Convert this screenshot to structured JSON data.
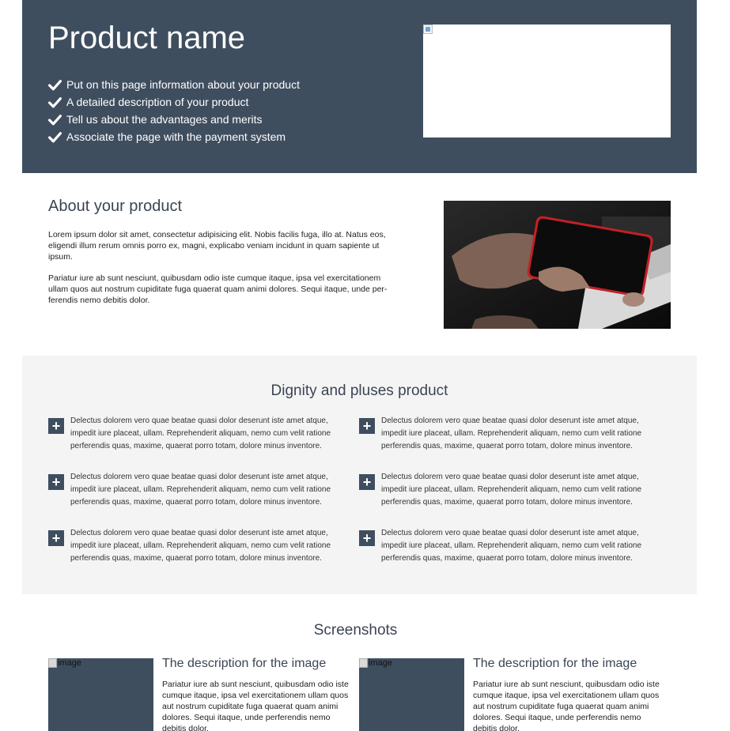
{
  "hero": {
    "title": "Product name",
    "features": [
      "Put on this page information about your product",
      "A detailed description of your product",
      "Tell us about the advantages and merits",
      "Associate the page with the payment system"
    ]
  },
  "about": {
    "title": "About your product",
    "paragraph1": "Lorem ipsum dolor sit amet, consectetur adipisicing elit. Nobis facilis fuga, illo at. Natus eos, eligendi illum rerum omnis porro ex, magni, explicabo veniam incidunt in quam sapiente ut ipsum.",
    "paragraph2": "Pariatur iure ab sunt nesciunt, quibusdam odio iste cumque itaque, ipsa vel exercitationem ullam quos aut nostrum cupiditate fuga quaerat quam animi dolores. Sequi itaque, unde per-ferendis nemo debitis dolor."
  },
  "dignity": {
    "title": "Dignity and pluses product",
    "items": [
      "Delectus dolorem vero quae beatae quasi dolor deserunt iste amet atque, impedit iure placeat, ullam. Reprehenderit aliquam, nemo cum velit ratione perferendis quas, maxime, quaerat porro totam, dolore minus inventore.",
      "Delectus dolorem vero quae beatae quasi dolor deserunt iste amet atque, impedit iure placeat, ullam. Reprehenderit aliquam, nemo cum velit ratione perferendis quas, maxime, quaerat porro totam, dolore minus inventore.",
      "Delectus dolorem vero quae beatae quasi dolor deserunt iste amet atque, impedit iure placeat, ullam. Reprehenderit aliquam, nemo cum velit ratione perferendis quas, maxime, quaerat porro totam, dolore minus inventore.",
      "Delectus dolorem vero quae beatae quasi dolor deserunt iste amet atque, impedit iure placeat, ullam. Reprehenderit aliquam, nemo cum velit ratione perferendis quas, maxime, quaerat porro totam, dolore minus inventore.",
      "Delectus dolorem vero quae beatae quasi dolor deserunt iste amet atque, impedit iure placeat, ullam. Reprehenderit aliquam, nemo cum velit ratione perferendis quas, maxime, quaerat porro totam, dolore minus inventore.",
      "Delectus dolorem vero quae beatae quasi dolor deserunt iste amet atque, impedit iure placeat, ullam. Reprehenderit aliquam, nemo cum velit ratione perferendis quas, maxime, quaerat porro totam, dolore minus inventore."
    ]
  },
  "screenshots": {
    "title": "Screenshots",
    "items": [
      {
        "image_alt": "image",
        "title": "The description for the image",
        "text": "Pariatur iure ab sunt nesciunt, quibusdam odio iste cumque itaque, ipsa vel exercitationem ullam quos aut nostrum cupiditate fuga quaerat quam animi dolores. Sequi itaque, unde perferendis nemo debitis dolor."
      },
      {
        "image_alt": "image",
        "title": "The description for the image",
        "text": "Pariatur iure ab sunt nesciunt, quibusdam odio iste cumque itaque, ipsa vel exercitationem ullam quos aut nostrum cupiditate fuga quaerat quam animi dolores. Sequi itaque, unde perferendis nemo debitis dolor."
      }
    ]
  },
  "colors": {
    "brand_dark": "#3f4e5f",
    "section_gray": "#f4f4f4",
    "heading": "#3b4553"
  },
  "icons": {
    "feature": "check-icon",
    "plus": "plus-icon",
    "broken_image": "broken-image-icon"
  }
}
